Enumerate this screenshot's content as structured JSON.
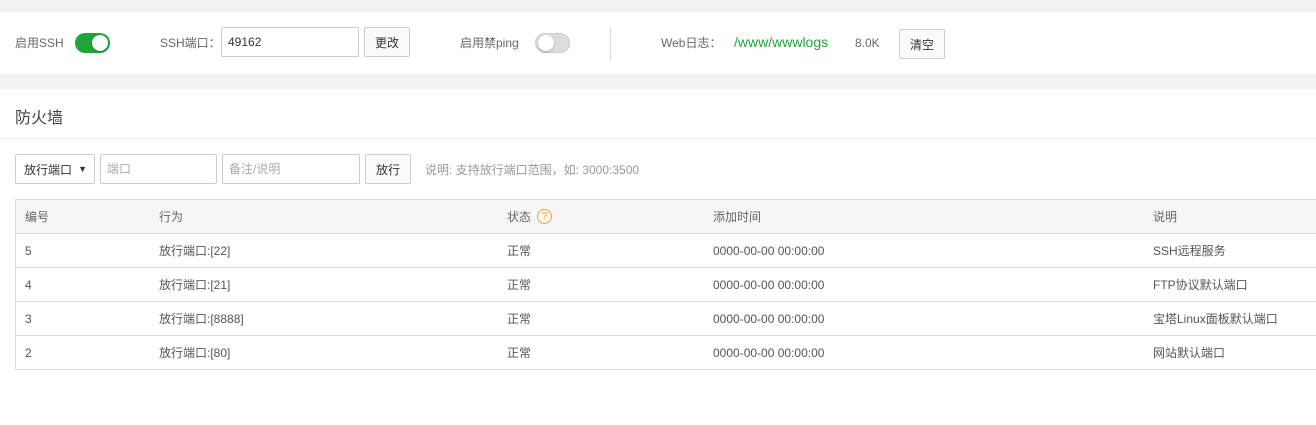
{
  "topbar": {
    "ssh_label": "启用SSH",
    "ssh_enabled": true,
    "ssh_port_label": "SSH端口：",
    "ssh_port_value": "49162",
    "change_button": "更改",
    "ping_label": "启用禁ping",
    "ping_enabled": false,
    "weblog_label": "Web日志：",
    "weblog_path": "/www/wwwlogs",
    "weblog_size": "8.0K",
    "clear_button": "清空"
  },
  "firewall": {
    "title": "防火墙",
    "action_select": "放行端口",
    "port_placeholder": "端口",
    "note_placeholder": "备注/说明",
    "allow_button": "放行",
    "hint": "说明: 支持放行端口范围，如: 3000:3500"
  },
  "table": {
    "headers": [
      "编号",
      "行为",
      "状态",
      "添加时间",
      "说明"
    ],
    "rows": [
      {
        "id": "5",
        "action": "放行端口:[22]",
        "status": "正常",
        "time": "0000-00-00 00:00:00",
        "note": "SSH远程服务"
      },
      {
        "id": "4",
        "action": "放行端口:[21]",
        "status": "正常",
        "time": "0000-00-00 00:00:00",
        "note": "FTP协议默认端口"
      },
      {
        "id": "3",
        "action": "放行端口:[8888]",
        "status": "正常",
        "time": "0000-00-00 00:00:00",
        "note": "宝塔Linux面板默认端口"
      },
      {
        "id": "2",
        "action": "放行端口:[80]",
        "status": "正常",
        "time": "0000-00-00 00:00:00",
        "note": "网站默认端口"
      }
    ]
  },
  "colors": {
    "accent_green": "#20a53a",
    "help_orange": "#f0a020"
  }
}
